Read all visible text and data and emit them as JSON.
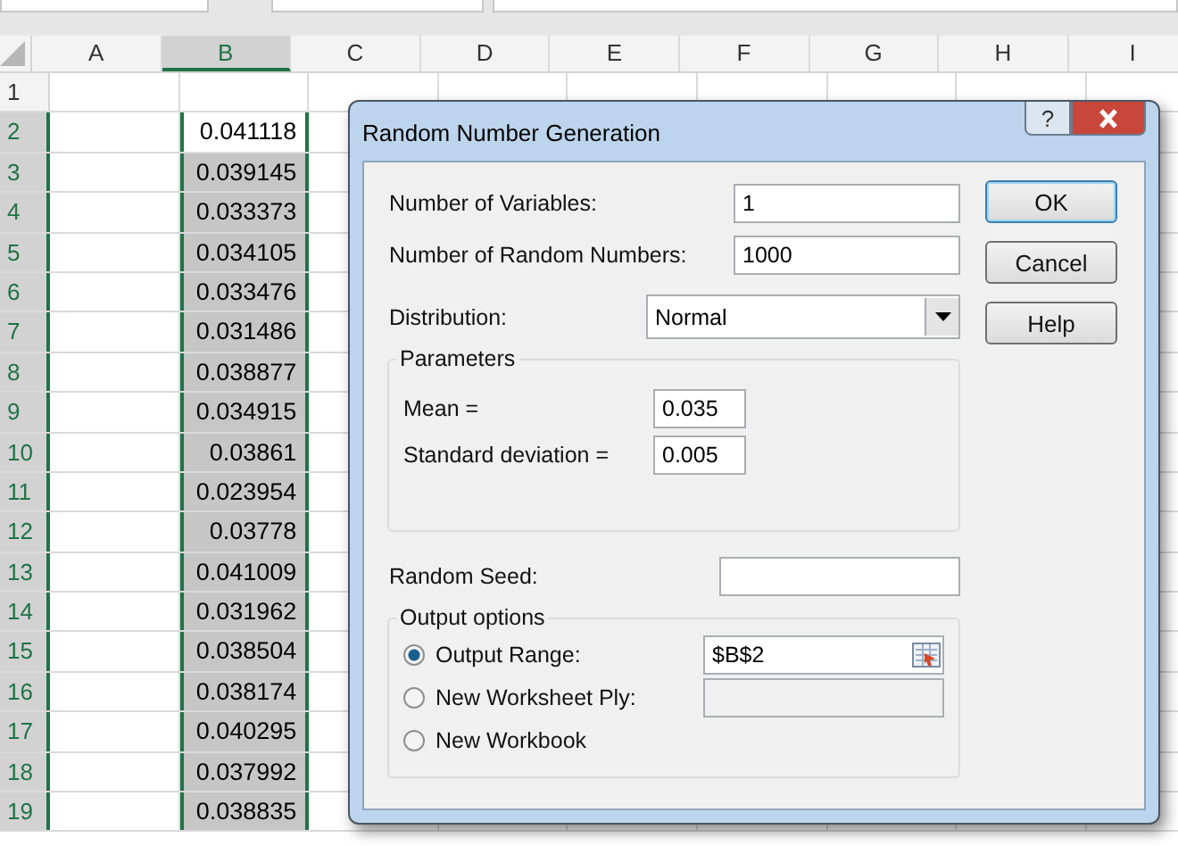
{
  "columns": [
    {
      "label": "A",
      "selected": false
    },
    {
      "label": "B",
      "selected": true
    },
    {
      "label": "C",
      "selected": false
    },
    {
      "label": "D",
      "selected": false
    },
    {
      "label": "E",
      "selected": false
    },
    {
      "label": "F",
      "selected": false
    },
    {
      "label": "G",
      "selected": false
    },
    {
      "label": "H",
      "selected": false
    },
    {
      "label": "I",
      "selected": false
    }
  ],
  "rows": [
    {
      "label": "1",
      "selected": false
    },
    {
      "label": "2",
      "value": "0.041118",
      "selected": true,
      "active": true
    },
    {
      "label": "3",
      "value": "0.039145",
      "selected": true,
      "active": false
    },
    {
      "label": "4",
      "value": "0.033373",
      "selected": true,
      "active": false
    },
    {
      "label": "5",
      "value": "0.034105",
      "selected": true,
      "active": false
    },
    {
      "label": "6",
      "value": "0.033476",
      "selected": true,
      "active": false
    },
    {
      "label": "7",
      "value": "0.031486",
      "selected": true,
      "active": false
    },
    {
      "label": "8",
      "value": "0.038877",
      "selected": true,
      "active": false
    },
    {
      "label": "9",
      "value": "0.034915",
      "selected": true,
      "active": false
    },
    {
      "label": "10",
      "value": "0.03861",
      "selected": true,
      "active": false
    },
    {
      "label": "11",
      "value": "0.023954",
      "selected": true,
      "active": false
    },
    {
      "label": "12",
      "value": "0.03778",
      "selected": true,
      "active": false
    },
    {
      "label": "13",
      "value": "0.041009",
      "selected": true,
      "active": false
    },
    {
      "label": "14",
      "value": "0.031962",
      "selected": true,
      "active": false
    },
    {
      "label": "15",
      "value": "0.038504",
      "selected": true,
      "active": false
    },
    {
      "label": "16",
      "value": "0.038174",
      "selected": true,
      "active": false
    },
    {
      "label": "17",
      "value": "0.040295",
      "selected": true,
      "active": false
    },
    {
      "label": "18",
      "value": "0.037992",
      "selected": true,
      "active": false
    },
    {
      "label": "19",
      "value": "0.038835",
      "selected": true,
      "active": false
    }
  ],
  "dialog": {
    "title": "Random Number Generation",
    "help_glyph": "?",
    "fields": [
      {
        "label": "Number of Variables:",
        "value": "1"
      },
      {
        "label": "Number of Random Numbers:",
        "value": "1000"
      }
    ],
    "distribution": {
      "label": "Distribution:",
      "value": "Normal"
    },
    "parameters": {
      "title": "Parameters",
      "fields": [
        {
          "label": "Mean =",
          "value": "0.035"
        },
        {
          "label": "Standard deviation =",
          "value": "0.005"
        }
      ]
    },
    "random_seed": {
      "label": "Random Seed:"
    },
    "output_options": {
      "title": "Output options",
      "options": [
        {
          "label": "Output Range:",
          "selected": true,
          "value": "$B$2",
          "enabled": true
        },
        {
          "label": "New Worksheet Ply:",
          "selected": false,
          "enabled": false
        },
        {
          "label": "New Workbook",
          "selected": false
        }
      ]
    },
    "buttons": [
      {
        "label": "OK",
        "default": true
      },
      {
        "label": "Cancel",
        "default": false
      },
      {
        "label": "Help",
        "default": false
      }
    ]
  }
}
